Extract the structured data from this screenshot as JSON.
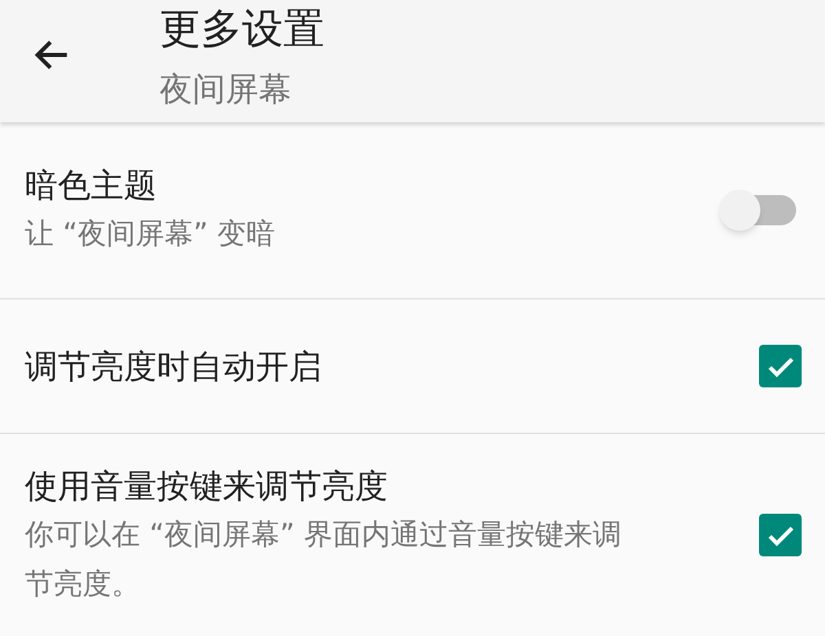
{
  "header": {
    "title": "更多设置",
    "subtitle": "夜间屏幕"
  },
  "settings": [
    {
      "kind": "switch",
      "title": "暗色主题",
      "summary": "让 “夜间屏幕” 变暗",
      "on": false
    },
    {
      "kind": "checkbox",
      "title": "调节亮度时自动开启",
      "checked": true
    },
    {
      "kind": "checkbox",
      "title": "使用音量按键来调节亮度",
      "summary": "你可以在 “夜间屏幕” 界面内通过音量按键来调节亮度。",
      "checked": true
    }
  ]
}
